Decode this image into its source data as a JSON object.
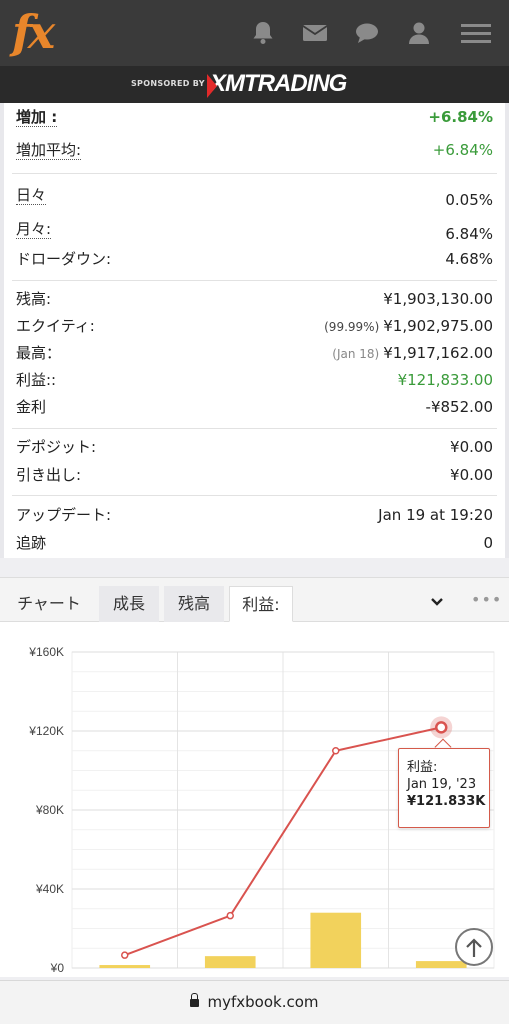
{
  "header": {
    "logo_text": "fx",
    "icons": [
      "bell-icon",
      "envelope-icon",
      "chat-icon",
      "user-icon",
      "menu-icon"
    ],
    "sponsor_label": "SPONSORED BY",
    "sponsor_name": "XMTRADING"
  },
  "stats": {
    "gain_label": "増加 :",
    "gain_value": "+6.84%",
    "abs_gain_label": "増加平均:",
    "abs_gain_value": "+6.84%",
    "daily_label": "日々",
    "daily_value": "0.05%",
    "monthly_label": "月々:",
    "monthly_value": "6.84%",
    "drawdown_label": "ドローダウン:",
    "drawdown_value": "4.68%",
    "balance_label": "残高:",
    "balance_value": "¥1,903,130.00",
    "equity_label": "エクイティ:",
    "equity_pct": "(99.99%)",
    "equity_value": "¥1,902,975.00",
    "highest_label": "最高：",
    "highest_date": "(Jan 18)",
    "highest_value": "¥1,917,162.00",
    "profit_label": "利益::",
    "profit_value": "¥121,833.00",
    "interest_label": "金利",
    "interest_value": "-¥852.00",
    "deposits_label": "デポジット:",
    "deposits_value": "¥0.00",
    "withdrawals_label": "引き出し:",
    "withdrawals_value": "¥0.00",
    "updated_label": "アップデート:",
    "updated_value": "Jan 19 at 19:20",
    "tracking_label": "追跡",
    "tracking_value": "0"
  },
  "colors": {
    "positive": "#3a9b3a",
    "line": "#d9534f",
    "bar": "#f2d25c",
    "logo": "#e8862b"
  },
  "tabs": [
    {
      "label": "チャート"
    },
    {
      "label": "成長"
    },
    {
      "label": "残高"
    },
    {
      "label": "利益:"
    }
  ],
  "active_tab": "利益:",
  "chart_data": {
    "type": "line",
    "y_ticks": [
      "¥0",
      "¥40K",
      "¥80K",
      "¥120K",
      "¥160K"
    ],
    "ylim": [
      0,
      160000
    ],
    "grid": true,
    "line_values": [
      6500,
      26500,
      110000,
      121833
    ],
    "bar_values": [
      1500,
      6000,
      28000,
      3500
    ]
  },
  "tooltip": {
    "series": "利益:",
    "date": "Jan 19, '23",
    "value": "¥121.833K"
  },
  "browser": {
    "url": "myfxbook.com"
  }
}
